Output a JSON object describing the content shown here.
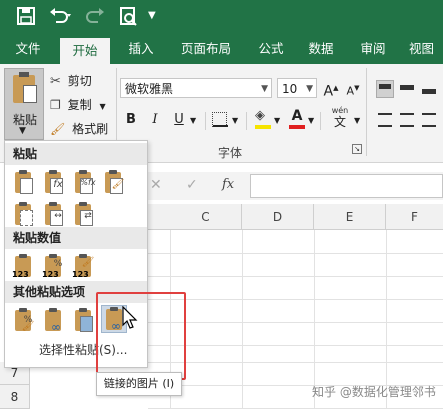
{
  "titlebar": {
    "save_icon": "save-icon",
    "undo_icon": "undo-icon",
    "redo_icon": "redo-icon",
    "preview_icon": "print-preview-icon"
  },
  "tabs": [
    {
      "label": "文件"
    },
    {
      "label": "开始"
    },
    {
      "label": "插入"
    },
    {
      "label": "页面布局"
    },
    {
      "label": "公式"
    },
    {
      "label": "数据"
    },
    {
      "label": "审阅"
    },
    {
      "label": "视图"
    }
  ],
  "ribbon": {
    "paste_label": "粘贴",
    "cut_label": "剪切",
    "copy_label": "复制",
    "format_painter_label": "格式刷",
    "font_name": "微软雅黑",
    "font_size": "10",
    "font_group_label": "字体",
    "increase_font": "A",
    "decrease_font": "A",
    "bold": "B",
    "italic": "I",
    "underline": "U",
    "wen_label": "wén",
    "highlight_color": "#f6e400",
    "font_color": "#e02020"
  },
  "formula_bar": {
    "fx": "fx",
    "cancel": "✕",
    "confirm": "✓"
  },
  "columns": [
    "C",
    "D",
    "E",
    "F"
  ],
  "rows": [
    "7",
    "8"
  ],
  "paste_menu": {
    "section1": "粘贴",
    "section2": "粘贴数值",
    "section3": "其他粘贴选项",
    "special": "选择性粘贴(S)..."
  },
  "tooltip": "链接的图片 (I)",
  "watermark": "知乎 @数据化管理邻书"
}
